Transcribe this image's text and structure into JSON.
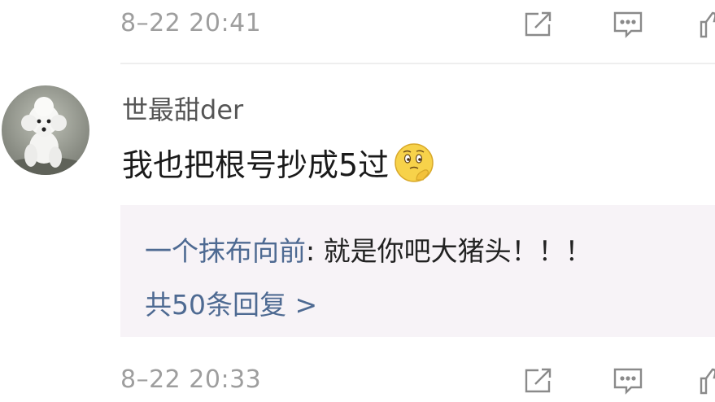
{
  "previous_comment": {
    "timestamp": "8–22 20:41"
  },
  "comment": {
    "username": "世最甜der",
    "text": "我也把根号抄成5过",
    "emoji": "thinking-face-emoji",
    "timestamp": "8–22 20:33"
  },
  "reply_preview": {
    "author": "一个抹布向前",
    "separator": ": ",
    "text": "就是你吧大猪头！！！",
    "more_label": "共50条回复 >"
  },
  "icons": {
    "share": "share-icon",
    "reply": "comment-icon",
    "like": "thumbs-up-icon"
  },
  "colors": {
    "timestamp": "#9e9e9e",
    "link": "#4e6a92",
    "reply_bg": "#f7f3f7",
    "text": "#1a1a1a"
  }
}
